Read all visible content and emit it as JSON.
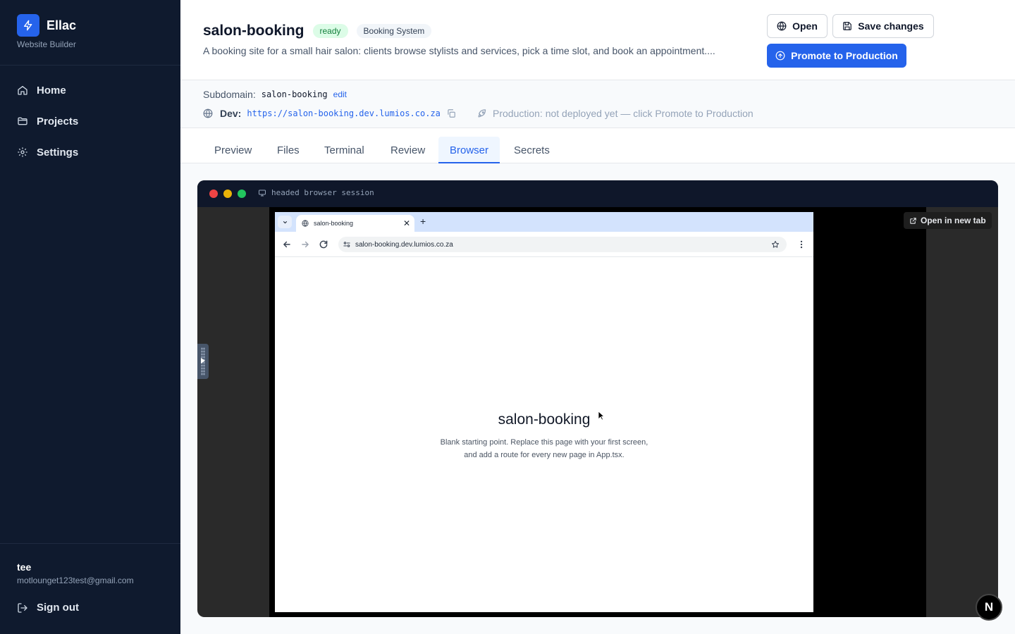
{
  "brand": {
    "name": "Ellac",
    "subtitle": "Website Builder",
    "accent": "#2563eb"
  },
  "sidebar": {
    "items": [
      {
        "label": "Home",
        "icon": "home-icon"
      },
      {
        "label": "Projects",
        "icon": "folder-icon"
      },
      {
        "label": "Settings",
        "icon": "gear-icon"
      }
    ],
    "user": {
      "name": "tee",
      "email": "motlounget123test@gmail.com"
    },
    "sign_out": "Sign out"
  },
  "project": {
    "name": "salon-booking",
    "status": "ready",
    "type": "Booking System",
    "description": "A booking site for a small hair salon: clients browse stylists and services, pick a time slot, and book an appointment...."
  },
  "actions": {
    "open": "Open",
    "save": "Save changes",
    "promote": "Promote to Production"
  },
  "info": {
    "subdomain_label": "Subdomain:",
    "subdomain_value": "salon-booking",
    "edit": "edit",
    "dev_label": "Dev:",
    "dev_url": "https://salon-booking.dev.lumios.co.za",
    "production": "Production: not deployed yet — click Promote to Production"
  },
  "tabs": [
    "Preview",
    "Files",
    "Terminal",
    "Review",
    "Browser",
    "Secrets"
  ],
  "active_tab": "Browser",
  "session": {
    "label": "headed browser session",
    "open_new_tab": "Open in new tab",
    "browser": {
      "tab_title": "salon-booking",
      "address": "salon-booking.dev.lumios.co.za",
      "page_title": "salon-booking",
      "page_desc": "Blank starting point. Replace this page with your first screen, and add a route for every new page in App.tsx."
    }
  },
  "floating_badge": "N"
}
